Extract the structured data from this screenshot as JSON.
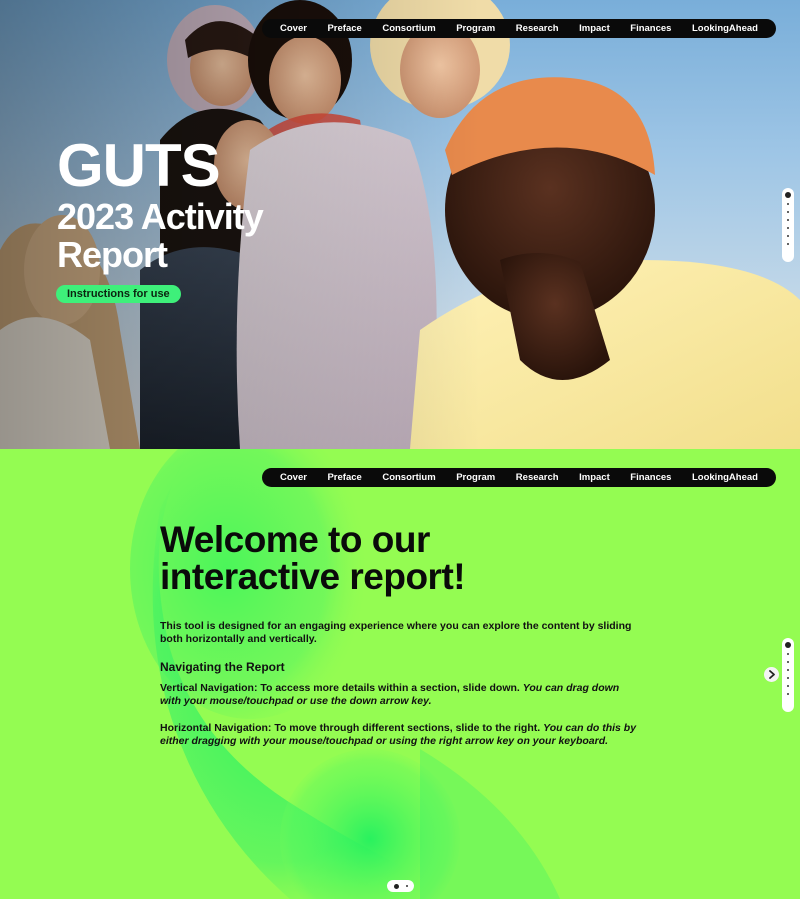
{
  "nav": {
    "items": [
      "Cover",
      "Preface",
      "Consortium",
      "Program",
      "Research",
      "Impact",
      "Finances",
      "LookingAhead"
    ]
  },
  "hero": {
    "title_line1": "GUTS",
    "title_line2": "2023 Activity",
    "title_line3": "Report",
    "instructions_label": "Instructions for use"
  },
  "welcome": {
    "heading_line1": "Welcome to our",
    "heading_line2": "interactive report!",
    "intro": "This tool is designed for an engaging experience where you can explore the content by sliding both horizontally and vertically.",
    "nav_heading": "Navigating the Report",
    "vertical_lead": "Vertical Navigation: To access more details within a section, slide down.",
    "vertical_tip": "You can drag down with your mouse/touchpad or use the down arrow key.",
    "horizontal_lead": "Horizontal Navigation: To move through different sections, slide to the right.",
    "horizontal_tip": "You can do this by either dragging with your mouse/touchpad or using the right arrow key on your keyboard."
  },
  "icons": {
    "next": "chevron-right-icon"
  },
  "colors": {
    "accent_green": "#94fc52",
    "button_green": "#3ef07a",
    "nav_bg": "#0a0a0a"
  }
}
